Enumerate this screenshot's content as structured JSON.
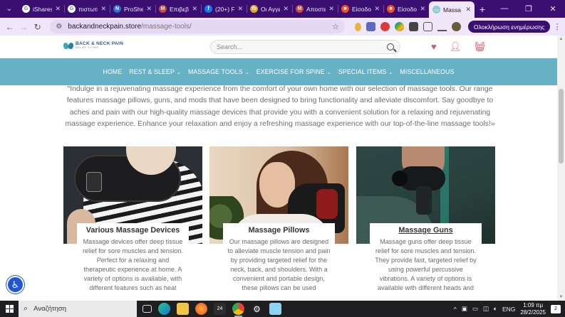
{
  "browser": {
    "tabs": [
      {
        "title": "iShares",
        "icon": "google-icon",
        "color": "#ffffff",
        "glyph": "G",
        "active": false
      },
      {
        "title": "πιστωτι",
        "icon": "google-icon",
        "color": "#ffffff",
        "glyph": "G",
        "active": false
      },
      {
        "title": "ProShe",
        "icon": "proshares-icon",
        "color": "#2b6fd6",
        "glyph": "N",
        "active": false
      },
      {
        "title": "Επιβεβ",
        "icon": "gmail-icon",
        "color": "#d44638",
        "glyph": "M",
        "active": false
      },
      {
        "title": "(20+) F",
        "icon": "facebook-icon",
        "color": "#1877f2",
        "glyph": "f",
        "active": false
      },
      {
        "title": "Οι Αγγε",
        "icon": "fb-brand-icon",
        "color": "#e8a21c",
        "glyph": "fb",
        "active": false
      },
      {
        "title": "Αποστε",
        "icon": "gmail-icon",
        "color": "#d44638",
        "glyph": "M",
        "active": false
      },
      {
        "title": "Είσοδο",
        "icon": "microsoft-icon",
        "color": "#f25022",
        "glyph": "■",
        "active": false
      },
      {
        "title": "Είσοδο",
        "icon": "microsoft-icon",
        "color": "#f25022",
        "glyph": "■",
        "active": false
      },
      {
        "title": "Massa",
        "icon": "site-favicon",
        "color": "#8ec9d6",
        "glyph": "▭",
        "active": true
      }
    ],
    "new_tab": "+",
    "window_controls": {
      "minimize": "—",
      "restore": "❐",
      "close": "✕"
    },
    "url_host": "backandneckpain.store",
    "url_path": "/massage-tools/",
    "update_button": "Ολοκλήρωση ενημέρωσης"
  },
  "site": {
    "logo_line1": "BACK & NECK PAIN",
    "logo_line2": "RELIEF STORE",
    "search_placeholder": "Search...",
    "nav": [
      {
        "label": "HOME",
        "dropdown": false,
        "active": false
      },
      {
        "label": "REST & SLEEP",
        "dropdown": true,
        "active": false
      },
      {
        "label": "MASSAGE TOOLS",
        "dropdown": true,
        "active": true
      },
      {
        "label": "EXERCISE FOR SPINE",
        "dropdown": true,
        "active": false
      },
      {
        "label": "SPECIAL ITEMS",
        "dropdown": true,
        "active": false
      },
      {
        "label": "MISCELLANEOUS",
        "dropdown": false,
        "active": false
      }
    ],
    "intro": "\"Indulge in a rejuvenating massage experience from the comfort of your own home with our selection of massage tools. Our range features massage pillows, guns, and mods that have been designed to bring functionality and alleviate discomfort. Say goodbye to aches and pain with our high-quality massage devices that provide you with a convenient solution for a relaxing and rejuvenating massage experience. Enhance your relaxation and enjoy a refreshing massage experience with our top-of-the-line massage tools!»",
    "cards": [
      {
        "title": "Various Massage Devices",
        "text": "Massage devices offer deep tissue relief for sore muscles and tension. Perfect for a relaxing and therapeutic experience at home. A variety of options is available, with different features such as heat"
      },
      {
        "title": "Massage Pillows",
        "text": "Our massage pillows are designed to alleviate muscle tension and pain by providing targeted relief for the neck, back, and shoulders. With a convenient and portable design, these pillows can be used"
      },
      {
        "title": "Massage Guns",
        "text": "Massage guns offer deep tissue relief for sore muscles and tension. They provide fast, targeted relief by using powerful percussive vibrations. A variety of options is available with different heads and"
      }
    ]
  },
  "taskbar": {
    "search_placeholder": "Αναζήτηση",
    "badge_count": "24",
    "language": "ENG",
    "time": "1:09 πμ",
    "date": "28/2/2025",
    "notification_count": "2"
  },
  "colors": {
    "tab_strip": "#3b0f72",
    "nav_bar": "#67b2c5",
    "accent_icons": "#d35a6a"
  }
}
